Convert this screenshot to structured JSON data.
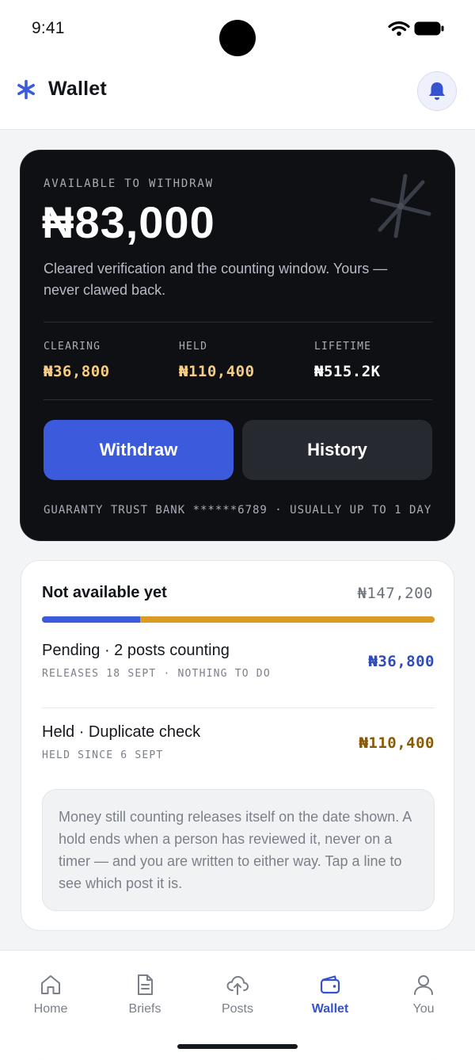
{
  "status_bar": {
    "time": "9:41"
  },
  "header": {
    "title": "Wallet",
    "logo_icon": "asterisk-icon",
    "bell_icon": "bell-icon"
  },
  "balance": {
    "label": "AVAILABLE TO WITHDRAW",
    "amount": "₦83,000",
    "note": "Cleared verification and the counting window. Yours — never clawed back.",
    "stats": [
      {
        "label": "CLEARING",
        "value": "₦36,800"
      },
      {
        "label": "HELD",
        "value": "₦110,400"
      },
      {
        "label": "LIFETIME",
        "value": "₦515.2K"
      }
    ],
    "withdraw_label": "Withdraw",
    "history_label": "History",
    "bank_line": "GUARANTY TRUST BANK ******6789 · USUALLY UP TO 1 DAY"
  },
  "pending": {
    "title": "Not available yet",
    "total": "₦147,200",
    "split_fraction_pending": 0.25,
    "items": [
      {
        "title": "Pending · 2 posts counting",
        "sub": "RELEASES 18 SEPT · NOTHING TO DO",
        "amount": "₦36,800"
      },
      {
        "title": "Held · Duplicate check",
        "sub": "HELD SINCE 6 SEPT",
        "amount": "₦110,400"
      }
    ],
    "info": "Money still counting releases itself on the date shown. A hold ends when a person has reviewed it, never on a timer — and you are written to either way. Tap a line to see which post it is."
  },
  "tabs": [
    {
      "label": "Home",
      "icon": "home-icon"
    },
    {
      "label": "Briefs",
      "icon": "document-icon"
    },
    {
      "label": "Posts",
      "icon": "cloud-upload-icon"
    },
    {
      "label": "Wallet",
      "icon": "wallet-icon",
      "active": true
    },
    {
      "label": "You",
      "icon": "user-icon"
    }
  ],
  "colors": {
    "accent": "#3c5bdc",
    "held": "#d99b22",
    "card_bg": "#0e1014"
  }
}
